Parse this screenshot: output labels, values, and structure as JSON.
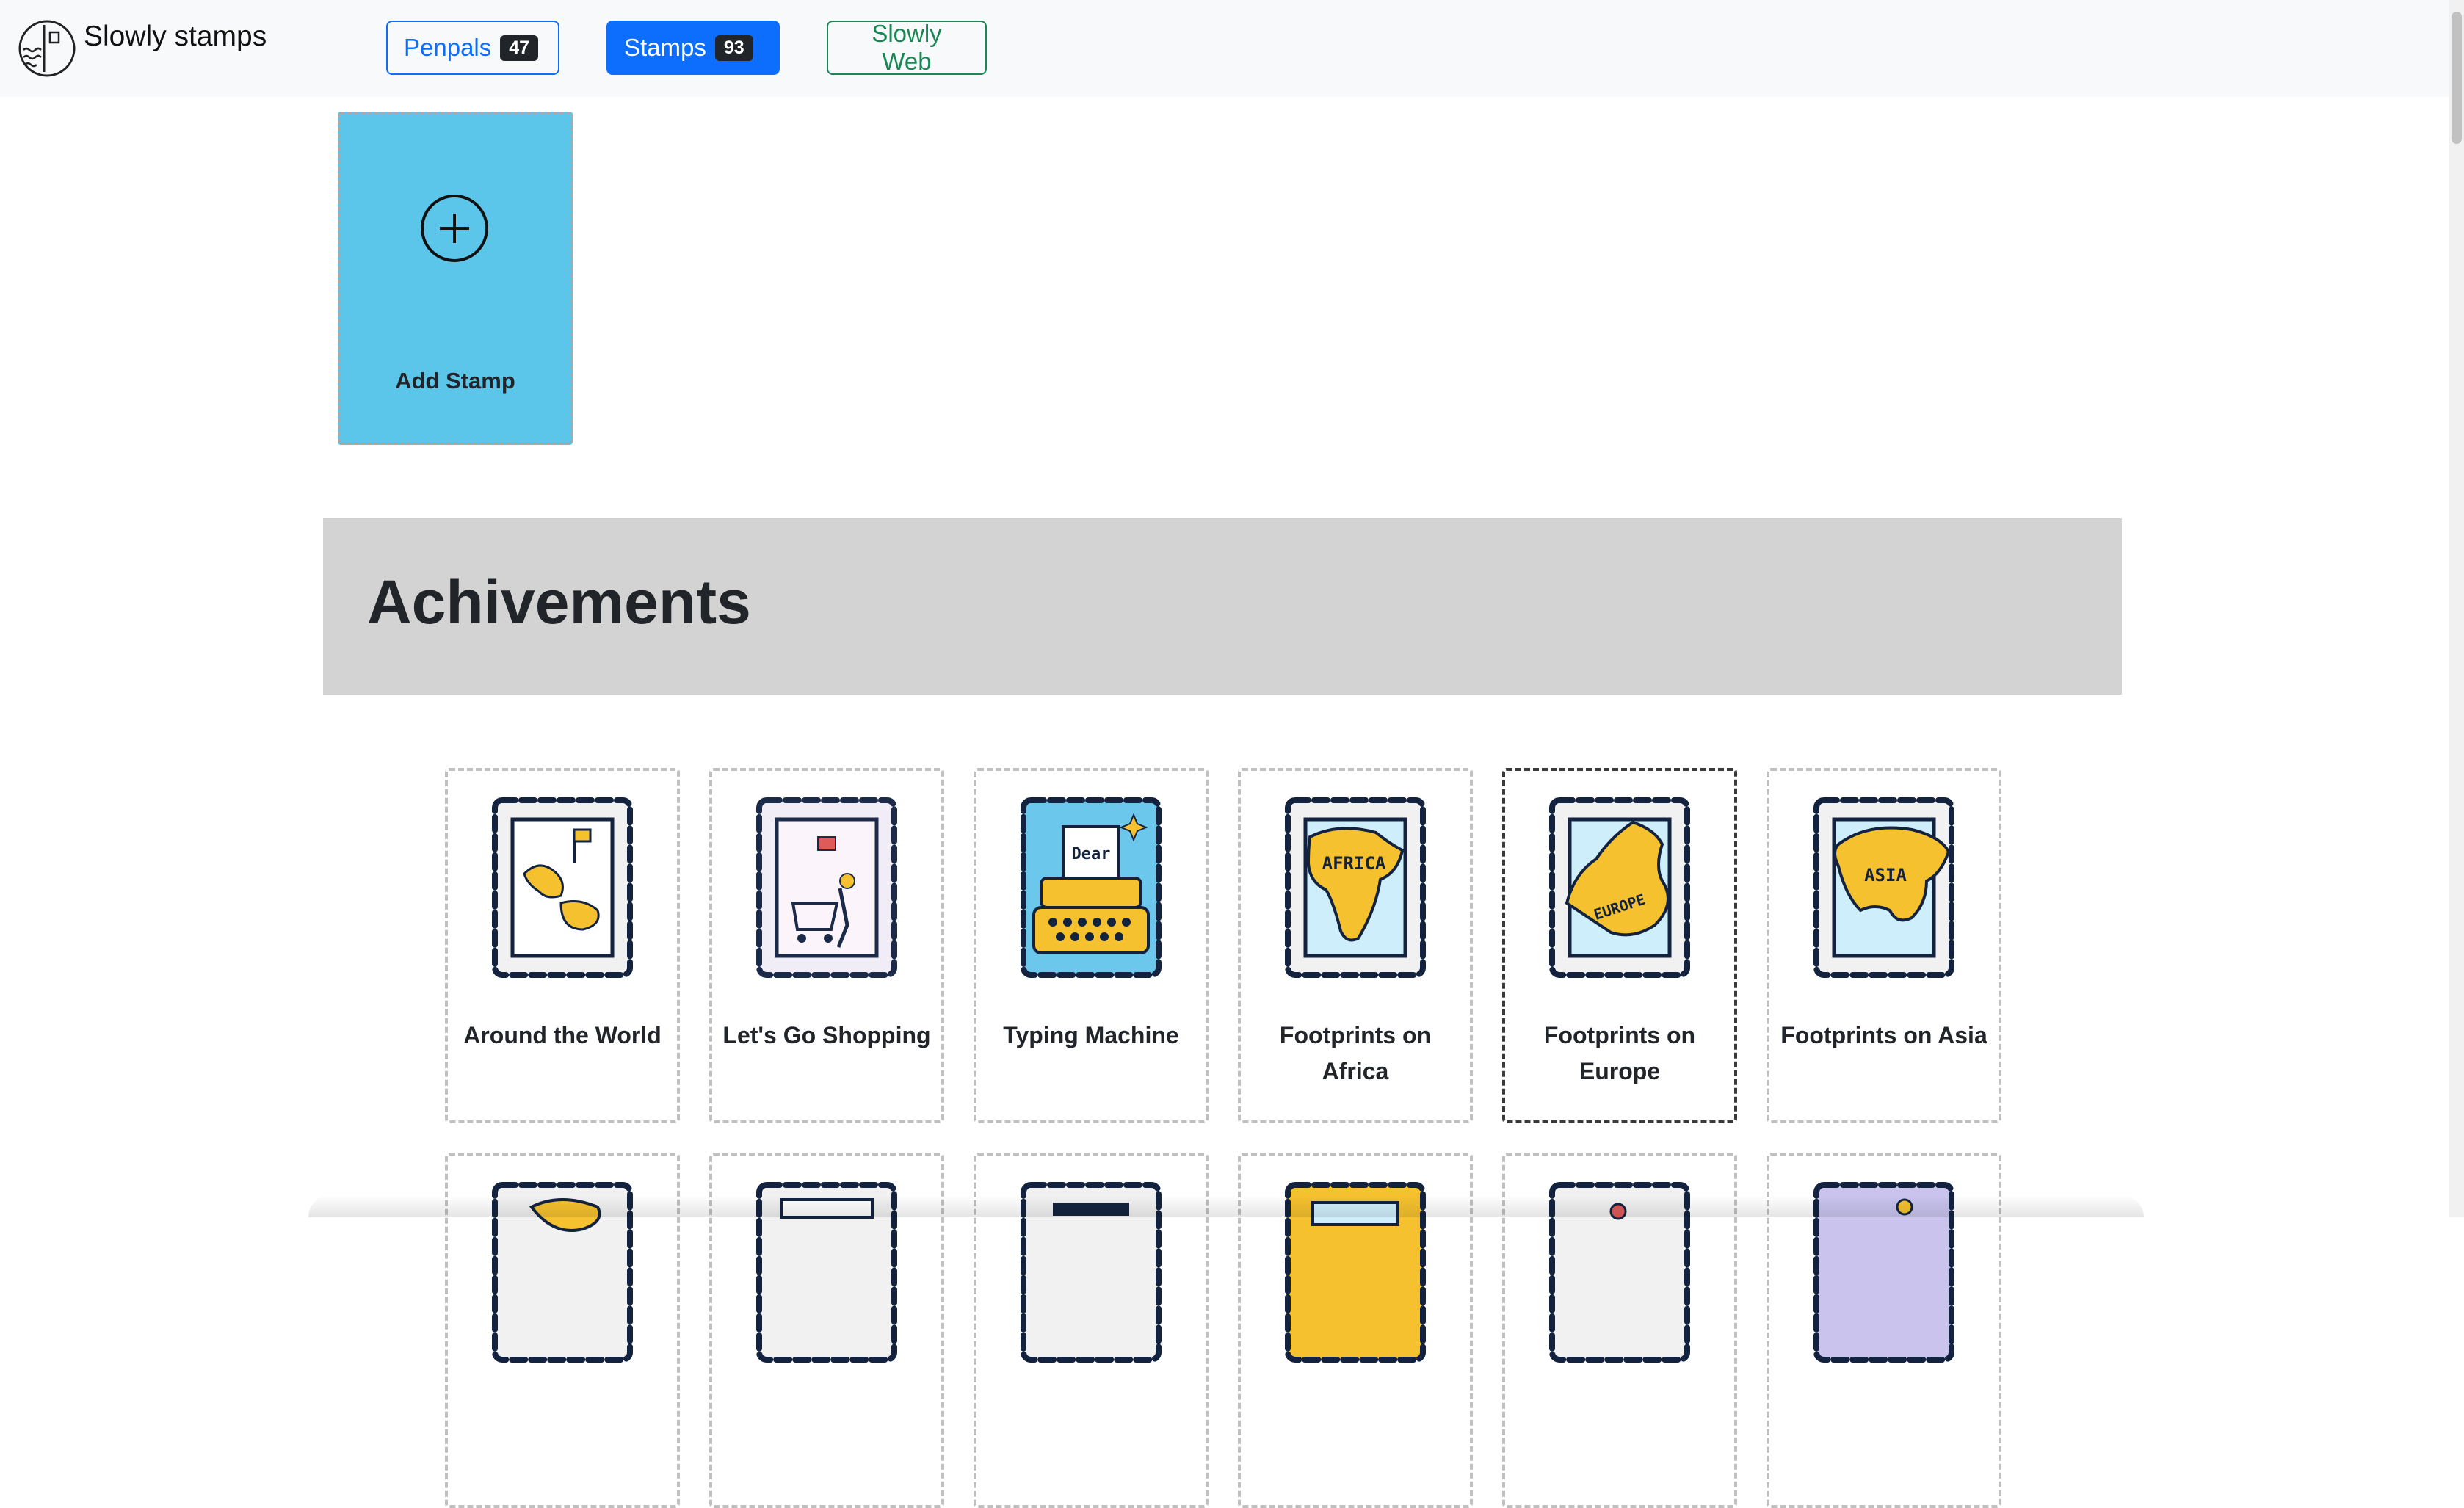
{
  "app": {
    "title": "Slowly stamps",
    "logo_icon": "envelope-wave-logo-icon"
  },
  "nav": {
    "penpals": {
      "label": "Penpals",
      "count": "47"
    },
    "stamps": {
      "label": "Stamps",
      "count": "93"
    },
    "web": {
      "label": "Slowly Web"
    }
  },
  "add_stamp": {
    "label": "Add Stamp",
    "icon": "plus-circle-icon"
  },
  "section": {
    "title": "Achivements"
  },
  "stamps": [
    {
      "label": "Around the World",
      "icon": "world-map-flag-icon",
      "frame": "#f1f1f1",
      "accent": "#f5c12e"
    },
    {
      "label": "Let's Go Shopping",
      "icon": "shopping-cart-icon",
      "frame": "#f1edf7",
      "accent": "#e05a5a"
    },
    {
      "label": "Typing Machine",
      "icon": "typewriter-icon",
      "frame": "#6cc7ec",
      "accent": "#f5c12e"
    },
    {
      "label": "Footprints on Africa",
      "icon": "africa-map-icon",
      "frame": "#f1f1f1",
      "accent": "#f5c12e"
    },
    {
      "label": "Footprints on Europe",
      "icon": "europe-map-icon",
      "frame": "#f1f1f1",
      "accent": "#f5c12e"
    },
    {
      "label": "Footprints on Asia",
      "icon": "asia-map-icon",
      "frame": "#f1f1f1",
      "accent": "#f5c12e"
    }
  ],
  "map_labels": {
    "africa": "AFRICA",
    "europe": "EUROPE",
    "asia": "ASIA",
    "dear": "Dear"
  },
  "colors": {
    "primary": "#0d6efd",
    "success": "#198754",
    "add_bg": "#5bc6ea",
    "section_bg": "#d3d3d3"
  }
}
